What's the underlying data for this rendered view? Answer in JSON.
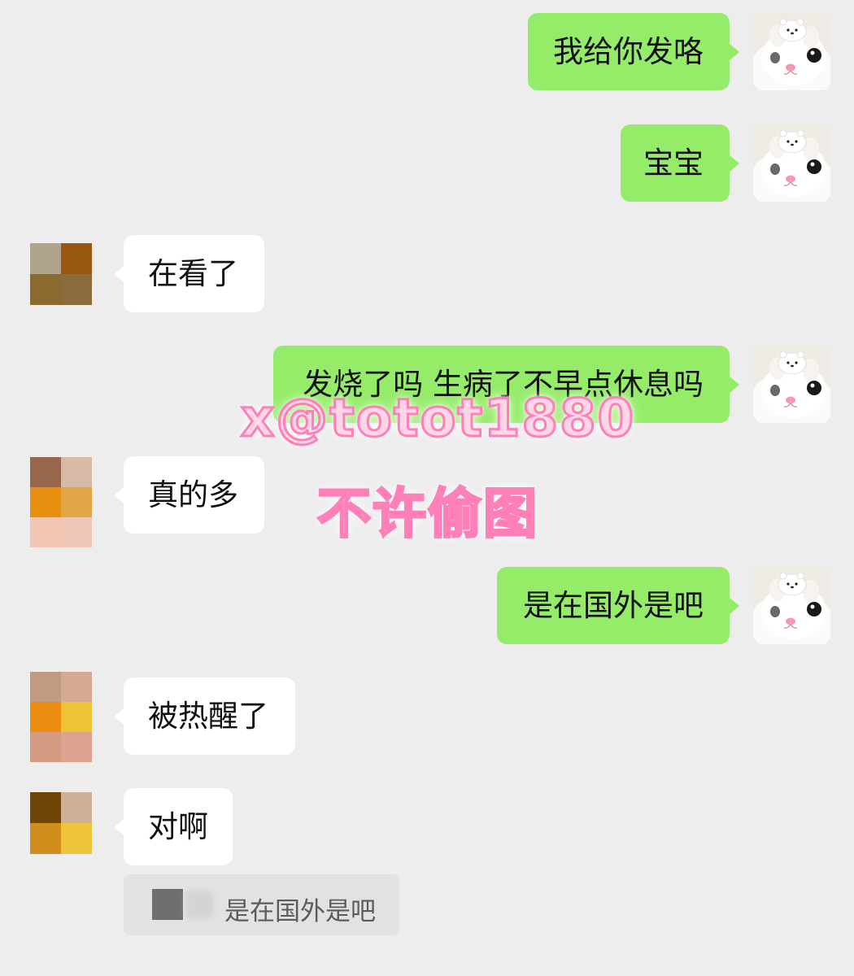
{
  "messages": [
    {
      "side": "sent",
      "text": "我给你发咯"
    },
    {
      "side": "sent",
      "text": "宝宝"
    },
    {
      "side": "received",
      "text": "在看了"
    },
    {
      "side": "sent",
      "text": "发烧了吗 生病了不早点休息吗"
    },
    {
      "side": "received",
      "text": "真的多"
    },
    {
      "side": "sent",
      "text": "是在国外是吧"
    },
    {
      "side": "received",
      "text": "被热醒了"
    },
    {
      "side": "received",
      "text": "对啊"
    }
  ],
  "quote": {
    "text": "是在国外是吧"
  },
  "watermark": {
    "line1": "x@totot1880",
    "line2": "不许偷图"
  },
  "colors": {
    "background": "#ededed",
    "sent_bubble": "#95ec69",
    "received_bubble": "#ffffff",
    "quote_background": "#e2e2e2",
    "watermark_fill": "#ffd6e8",
    "watermark_stroke": "#ff7fb8"
  },
  "avatars": {
    "self": "white-cat-avatar",
    "other": "pixelated-avatar"
  }
}
